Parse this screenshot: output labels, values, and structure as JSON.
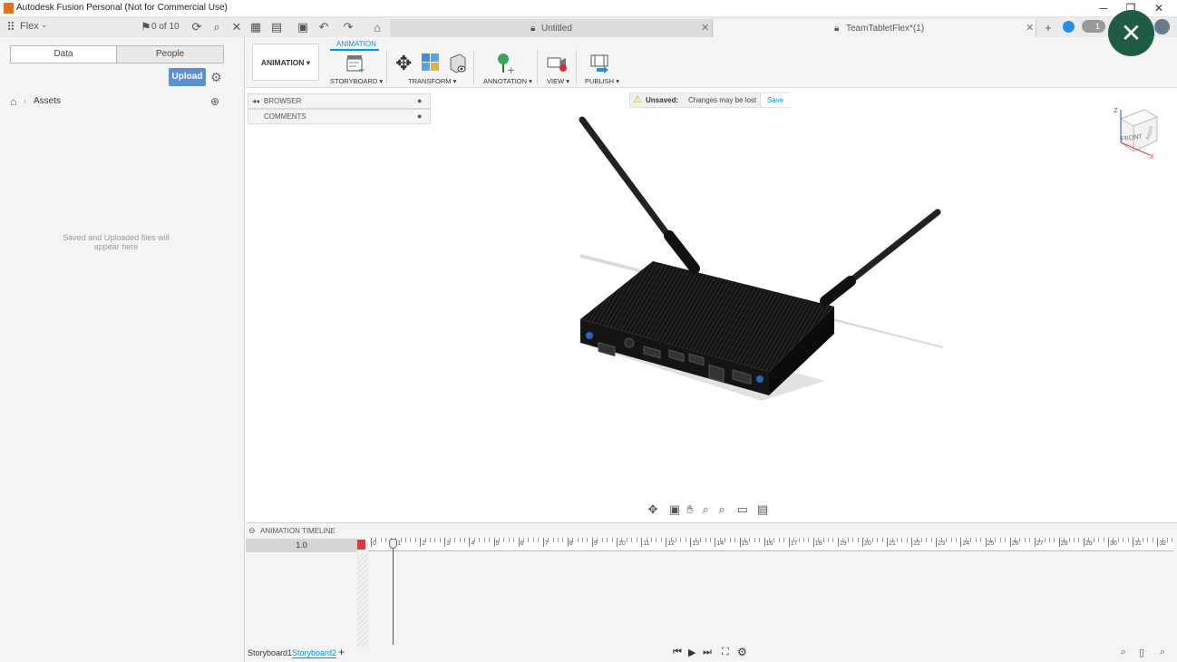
{
  "window": {
    "title": "Autodesk Fusion Personal (Not for Commercial Use)",
    "minimize": "─",
    "restore": "❐",
    "close": "✕"
  },
  "app_toolbar": {
    "team_label": "Flex",
    "jobs_label": "0 of 10"
  },
  "doc_tabs": [
    {
      "label": "Untitled",
      "close": "✕"
    },
    {
      "label": "TeamTabletFlex*(1)",
      "close": "✕"
    }
  ],
  "notification_count": "1",
  "data_panel": {
    "segments": [
      "Data",
      "People"
    ],
    "upload_label": "Upload",
    "breadcrumb": "Assets",
    "empty_message_line1": "Saved and Uploaded files will",
    "empty_message_line2": "appear here"
  },
  "ribbon": {
    "workspace": "ANIMATION",
    "active_tab": "ANIMATION",
    "groups": [
      "STORYBOARD",
      "TRANSFORM",
      "ANNOTATION",
      "VIEW",
      "PUBLISH"
    ]
  },
  "browser_panel": {
    "browser_label": "BROWSER",
    "comments_label": "COMMENTS"
  },
  "unsaved_bar": {
    "label": "Unsaved:",
    "message": "Changes may be lost",
    "save_label": "Save"
  },
  "viewcube": {
    "face": "FRONT",
    "right": "RIGHT",
    "z": "Z",
    "x": "X"
  },
  "timeline": {
    "header": "ANIMATION TIMELINE",
    "time_value": "1.0",
    "tick_labels": [
      "0",
      "1",
      "2",
      "3",
      "4",
      "5",
      "6",
      "7",
      "8",
      "9",
      "10",
      "11",
      "12",
      "13",
      "14",
      "15",
      "16",
      "17",
      "18",
      "19",
      "20",
      "21",
      "22",
      "23",
      "24",
      "25",
      "26",
      "27",
      "28",
      "29",
      "30",
      "31",
      "32"
    ],
    "storyboards": [
      "Storyboard1",
      "Storyboard2"
    ],
    "add_label": "+"
  },
  "colors": {
    "accent": "#0696d7",
    "upload": "#5b8fcf",
    "fab": "#1e5c43",
    "ribbon_bg": "#f5f5f5"
  }
}
